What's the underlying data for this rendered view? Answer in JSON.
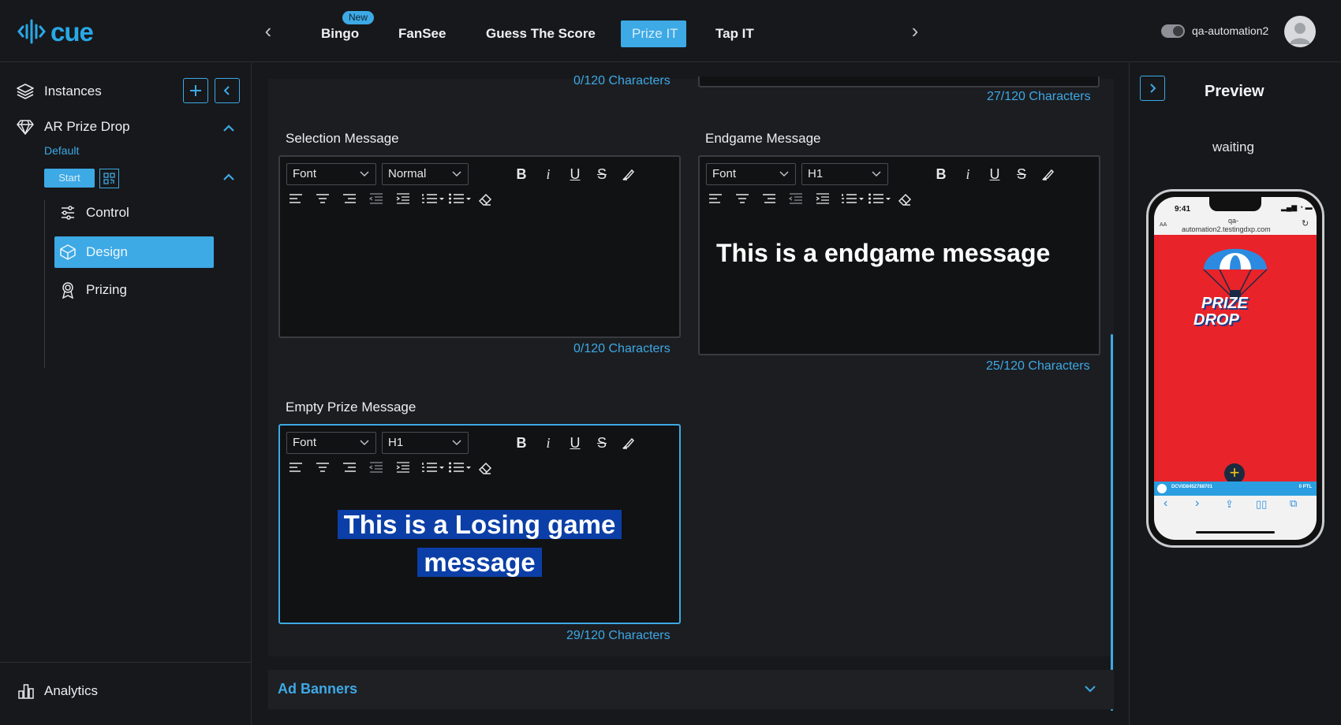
{
  "app": {
    "logo_text": "cue"
  },
  "topnav": {
    "tabs": [
      {
        "label": "Bingo",
        "badge": "New"
      },
      {
        "label": "FanSee"
      },
      {
        "label": "Guess The Score"
      },
      {
        "label": "Prize IT",
        "active": true
      },
      {
        "label": "Tap IT"
      }
    ],
    "user_name": "qa-automation2"
  },
  "sidebar": {
    "instances_label": "Instances",
    "instance_name": "AR Prize Drop",
    "default_label": "Default",
    "start_label": "Start",
    "menu": [
      {
        "label": "Control",
        "icon": "sliders-icon"
      },
      {
        "label": "Design",
        "icon": "cube-icon",
        "active": true
      },
      {
        "label": "Prizing",
        "icon": "award-icon"
      }
    ],
    "analytics_label": "Analytics"
  },
  "main": {
    "top_left_count": "0/120 Characters",
    "top_right_count": "27/120 Characters",
    "selection": {
      "label": "Selection Message",
      "font": "Font",
      "size": "Normal",
      "text": "",
      "count": "0/120 Characters"
    },
    "endgame": {
      "label": "Endgame Message",
      "font": "Font",
      "size": "H1",
      "text": "This is a endgame message",
      "count": "25/120 Characters"
    },
    "empty_prize": {
      "label": "Empty Prize Message",
      "font": "Font",
      "size": "H1",
      "text_line1": "This is a Losing game",
      "text_line2": "message",
      "count": "29/120 Characters"
    },
    "ad_banners_label": "Ad Banners"
  },
  "preview": {
    "title": "Preview",
    "status": "waiting",
    "phone": {
      "time": "9:41",
      "url_line1": "qa-",
      "url_line2": "automation2.testingdxp.com",
      "aa": "AA",
      "game_title_line1": "PRIZE",
      "game_title_line2": "DROP",
      "footer_id": "DCVID8452788701",
      "footer_points": "0 PTL"
    }
  },
  "colors": {
    "accent": "#3da9e5",
    "phone_bg": "#e8232a",
    "highlight": "#0b3fa7"
  }
}
